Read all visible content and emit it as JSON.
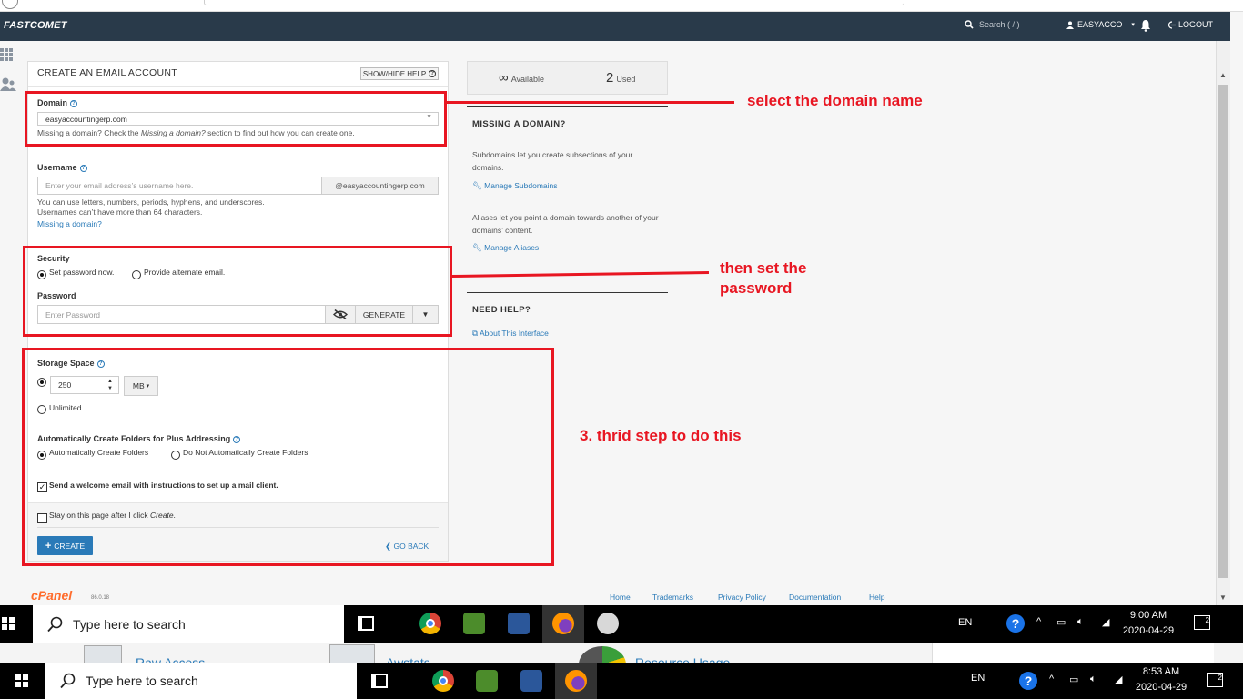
{
  "navbar": {
    "logo": "FASTCOMET",
    "search_placeholder": "Search ( / )",
    "user": "EASYACCO",
    "logout": "LOGOUT"
  },
  "form": {
    "title": "CREATE AN EMAIL ACCOUNT",
    "help_toggle": "SHOW/HIDE HELP",
    "domain": {
      "label": "Domain",
      "value": "easyaccountingerp.com",
      "help_prefix": "Missing a domain? Check the ",
      "help_em": "Missing a domain?",
      "help_suffix": " section to find out how you can create one."
    },
    "username": {
      "label": "Username",
      "placeholder": "Enter your email address’s username here.",
      "suffix": "@easyaccountingerp.com",
      "help1": "You can use letters, numbers, periods, hyphens, and underscores.",
      "help2": "Usernames can’t have more than 64 characters.",
      "missing_link": "Missing a domain?"
    },
    "security": {
      "label": "Security",
      "option1": "Set password now.",
      "option2": "Provide alternate email.",
      "selected": "Set password now."
    },
    "password": {
      "label": "Password",
      "placeholder": "Enter Password",
      "generate": "GENERATE"
    },
    "storage": {
      "label": "Storage Space",
      "value": "250",
      "unit": "MB",
      "unlimited": "Unlimited",
      "selected": "250"
    },
    "plus_addressing": {
      "label": "Automatically Create Folders for Plus Addressing",
      "option1": "Automatically Create Folders",
      "option2": "Do Not Automatically Create Folders",
      "selected": "Automatically Create Folders"
    },
    "welcome_email": {
      "label": "Send a welcome email with instructions to set up a mail client.",
      "checked": true
    },
    "stay_on_page": {
      "prefix": "Stay on this page after I click ",
      "em": "Create",
      "suffix": ".",
      "checked": false
    },
    "create_button": "CREATE",
    "go_back": "GO BACK"
  },
  "sidebar": {
    "available_symbol": "∞",
    "available_label": "Available",
    "used_count": "2",
    "used_label": "Used",
    "missing_heading": "MISSING A DOMAIN?",
    "subdomains_text": "Subdomains let you create subsections of your domains.",
    "manage_subdomains": "Manage Subdomains",
    "aliases_text": "Aliases let you point a domain towards another of your domains’ content.",
    "manage_aliases": "Manage Aliases",
    "need_help": "NEED HELP?",
    "about": "About This Interface"
  },
  "annotations": {
    "a1": "select the domain name",
    "a2_line1": "then set the",
    "a2_line2": "password",
    "a3": "3. thrid step to do this"
  },
  "footer": {
    "brand": "cPanel",
    "version": "86.0.18",
    "links": [
      "Home",
      "Trademarks",
      "Privacy Policy",
      "Documentation",
      "Help"
    ]
  },
  "taskbar_top": {
    "search": "Type here to search",
    "lang": "EN",
    "time": "9:00 AM",
    "date": "2020-04-29",
    "notif": "2"
  },
  "under_strip": {
    "items": [
      "Raw Access",
      "Awstats",
      "Resource Usage"
    ]
  },
  "taskbar_bottom": {
    "search": "Type here to search",
    "lang": "EN",
    "time": "8:53 AM",
    "date": "2020-04-29",
    "notif": "2"
  },
  "colors": {
    "navbar": "#293a4a",
    "accent": "#2a7ab8",
    "annotation": "#e81622",
    "cpanel": "#ff6c2c"
  }
}
